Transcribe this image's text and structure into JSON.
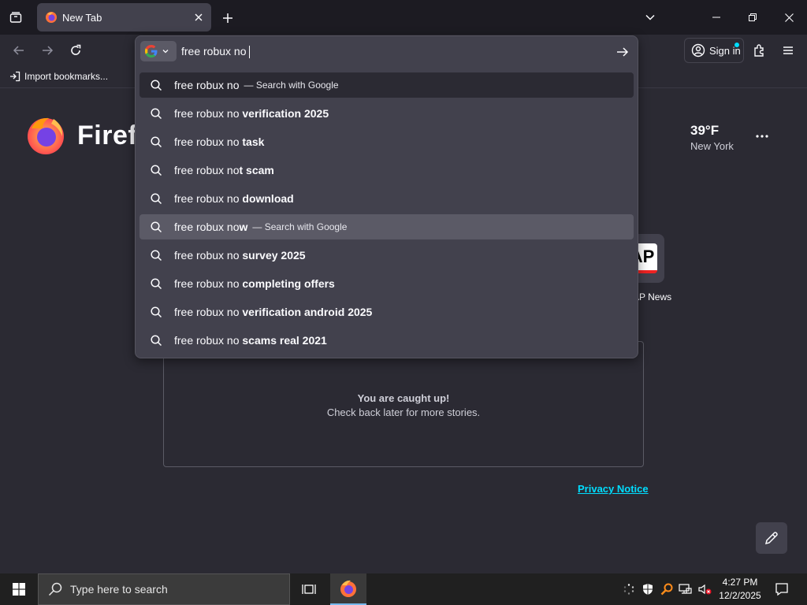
{
  "tab": {
    "title": "New Tab"
  },
  "bookmarks": {
    "import_label": "Import bookmarks..."
  },
  "toolbar": {
    "signin_label": "Sign in"
  },
  "urlbar": {
    "value": "free robux no",
    "results": [
      {
        "typed": "free robux no",
        "suggest": "",
        "action": "— Search with Google",
        "state": "selected"
      },
      {
        "typed": "free robux no ",
        "suggest": "verification 2025",
        "action": "",
        "state": ""
      },
      {
        "typed": "free robux no ",
        "suggest": "task",
        "action": "",
        "state": ""
      },
      {
        "typed": "free robux no",
        "suggest": "t scam",
        "action": "",
        "state": ""
      },
      {
        "typed": "free robux no ",
        "suggest": "download",
        "action": "",
        "state": ""
      },
      {
        "typed": "free robux no",
        "suggest": "w",
        "action": "— Search with Google",
        "state": "hovered"
      },
      {
        "typed": "free robux no ",
        "suggest": "survey 2025",
        "action": "",
        "state": ""
      },
      {
        "typed": "free robux no ",
        "suggest": "completing offers",
        "action": "",
        "state": ""
      },
      {
        "typed": "free robux no ",
        "suggest": "verification android 2025",
        "action": "",
        "state": ""
      },
      {
        "typed": "free robux no ",
        "suggest": "scams real 2021",
        "action": "",
        "state": ""
      }
    ]
  },
  "newtab": {
    "brand": "Firefox",
    "weather": {
      "temp": "39°F",
      "city": "New York"
    },
    "shortcut": {
      "label": "AP News",
      "logo_text": "AP"
    },
    "stories": {
      "caught_up": "You are caught up!",
      "check_back": "Check back later for more stories."
    },
    "privacy_label": "Privacy Notice"
  },
  "taskbar": {
    "search_placeholder": "Type here to search",
    "time": "4:27 PM",
    "date": "12/2/2025"
  },
  "colors": {
    "accent": "#00ddff",
    "background": "#2b2a33",
    "panel": "#42414d"
  },
  "icons": [
    "tab-list-icon",
    "firefox-icon",
    "close-icon",
    "plus-icon",
    "chevron-down-icon",
    "minimize-icon",
    "restore-icon",
    "back-icon",
    "forward-icon",
    "reload-icon",
    "google-icon",
    "arrow-right-icon",
    "account-icon",
    "extensions-icon",
    "menu-icon",
    "import-icon",
    "search-icon",
    "more-icon",
    "pencil-icon",
    "windows-icon",
    "task-view-icon"
  ]
}
